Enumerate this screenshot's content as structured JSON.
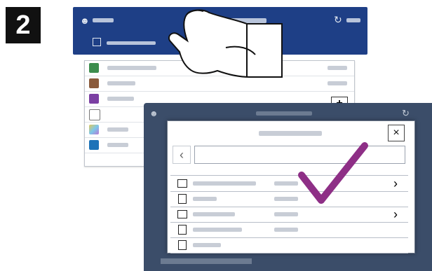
{
  "step": {
    "number": "2"
  },
  "back_panel": {
    "header_icon": "user-icon",
    "refresh_icon": "refresh-icon",
    "search_icon": "scan-icon",
    "list_icons": [
      {
        "name": "app-icon-green",
        "color": "#3c8d4d"
      },
      {
        "name": "app-icon-photo",
        "color": "#8a5a3b"
      },
      {
        "name": "app-icon-purple",
        "color": "#7b3fa3"
      },
      {
        "name": "app-icon-doc",
        "color": "#777777"
      },
      {
        "name": "app-icon-gradient",
        "color": "#e2c85b"
      },
      {
        "name": "app-icon-blue",
        "color": "#1d73b8"
      }
    ],
    "plus_label": "+"
  },
  "front_panel": {
    "close_label": "×",
    "back_label": "‹",
    "rows": [
      {
        "icon": "folder-icon",
        "has_chevron": true
      },
      {
        "icon": "file-icon",
        "has_chevron": false
      },
      {
        "icon": "folder-icon",
        "has_chevron": true
      },
      {
        "icon": "file-icon",
        "has_chevron": false
      },
      {
        "icon": "file-icon",
        "has_chevron": false
      }
    ],
    "chevron_label": "›"
  },
  "accent": {
    "header_blue": "#1e3f86",
    "check_purple": "#8e2f86"
  }
}
